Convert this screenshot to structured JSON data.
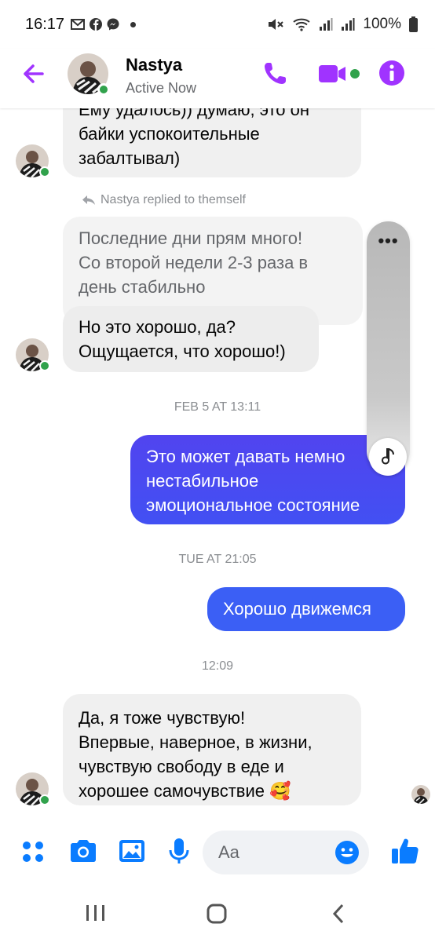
{
  "status_bar": {
    "time": "16:17",
    "notification_icons": [
      "gmail-icon",
      "facebook-icon",
      "messenger-icon",
      "dot-icon"
    ],
    "battery": "100%",
    "system_icons": [
      "mute-icon",
      "wifi-icon",
      "signal-icon",
      "signal-icon",
      "battery-icon"
    ]
  },
  "header": {
    "name": "Nastya",
    "status": "Active Now",
    "accent_color": "#a033ff",
    "active_color": "#31a24c"
  },
  "messages": {
    "m1": {
      "lines": [
        "Ему удалось)) думаю, это он",
        "байки успокоительные",
        "забалтывал)"
      ]
    },
    "reply_note": "Nastya replied to themself",
    "m2": {
      "lines": [
        "Последние дни прям много!",
        "Со второй недели 2-3 раза в",
        "день стабильно"
      ]
    },
    "m3": {
      "lines": [
        "Но это хорошо, да?",
        "Ощущается, что хорошо!)"
      ]
    },
    "ts1": "FEB 5 AT 13:11",
    "m4": {
      "lines": [
        "Это может давать немно",
        "нестабильное",
        "эмоциональное состояние"
      ]
    },
    "ts2": "TUE AT 21:05",
    "m5": {
      "lines": [
        "Хорошо движемся"
      ]
    },
    "ts3": "12:09",
    "m6": {
      "lines": [
        "Да, я тоже чувствую!",
        "Впервые, наверное, в жизни,",
        "чувствую свободу в еде и",
        "хорошее самочувствие 🥰"
      ]
    }
  },
  "float_panel": {
    "menu": "•••",
    "icon": "♪"
  },
  "composer": {
    "placeholder": "Aa",
    "icons": [
      "apps-icon",
      "camera-icon",
      "gallery-icon",
      "microphone-icon",
      "emoji-icon",
      "thumbs-up-icon"
    ]
  },
  "outgoing_color": "#4250f3"
}
